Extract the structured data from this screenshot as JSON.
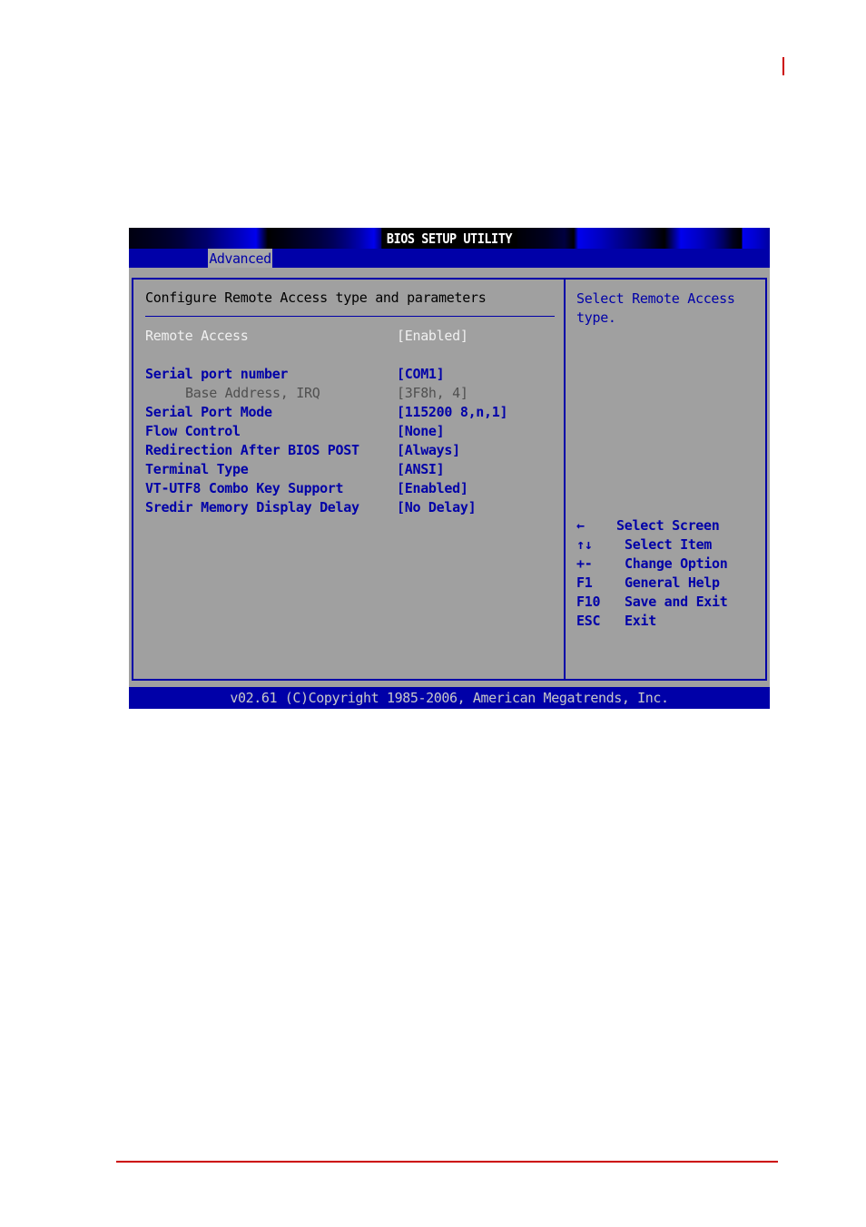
{
  "document": {
    "accent_color": "#cc0000"
  },
  "bios": {
    "title": "BIOS SETUP UTILITY",
    "tabs": [
      {
        "label": "Advanced",
        "active": true
      }
    ],
    "section_title": "Configure Remote Access type and parameters",
    "settings": [
      {
        "label": "Remote Access",
        "value": "[Enabled]",
        "state": "selected"
      },
      {
        "label": "Serial port number",
        "value": "[COM1]",
        "state": "normal"
      },
      {
        "label": "Base Address, IRQ",
        "value": "[3F8h, 4]",
        "state": "readonly"
      },
      {
        "label": "Serial Port Mode",
        "value": "[115200 8,n,1]",
        "state": "normal"
      },
      {
        "label": "Flow Control",
        "value": "[None]",
        "state": "normal"
      },
      {
        "label": "Redirection After BIOS POST",
        "value": "[Always]",
        "state": "normal"
      },
      {
        "label": "Terminal Type",
        "value": "[ANSI]",
        "state": "normal"
      },
      {
        "label": "VT-UTF8 Combo Key Support",
        "value": "[Enabled]",
        "state": "normal"
      },
      {
        "label": "Sredir Memory Display Delay",
        "value": "[No Delay]",
        "state": "normal"
      }
    ],
    "help": {
      "text": "Select Remote Access type.",
      "keys": [
        {
          "key": "←",
          "desc": "Select Screen",
          "icon": "left-arrow-icon"
        },
        {
          "key": "↑↓",
          "desc": "Select Item",
          "icon": "up-down-arrows-icon"
        },
        {
          "key": "+-",
          "desc": "Change Option",
          "icon": "plus-minus-icon"
        },
        {
          "key": "F1",
          "desc": "General Help"
        },
        {
          "key": "F10",
          "desc": "Save and Exit"
        },
        {
          "key": "ESC",
          "desc": "Exit"
        }
      ]
    },
    "status": "v02.61 (C)Copyright 1985-2006, American Megatrends, Inc.",
    "colors": {
      "background": "#a0a0a0",
      "bar": "#0000a8",
      "selected_text": "#f0f0f0",
      "readonly_text": "#505050"
    }
  }
}
